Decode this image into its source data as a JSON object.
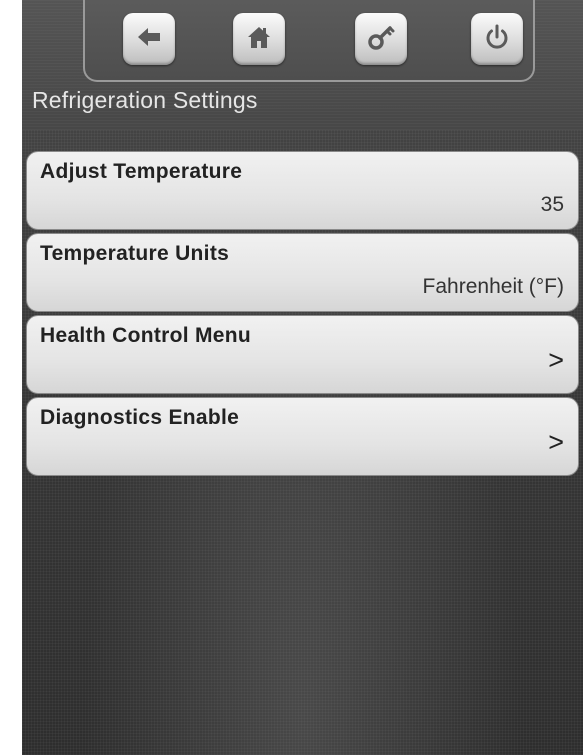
{
  "nav": {
    "buttons": [
      {
        "icon": "back-arrow-icon"
      },
      {
        "icon": "home-icon"
      },
      {
        "icon": "key-icon"
      },
      {
        "icon": "power-icon"
      }
    ]
  },
  "page": {
    "title": "Refrigeration Settings"
  },
  "menu": {
    "items": [
      {
        "label": "Adjust Temperature",
        "value": "35"
      },
      {
        "label": "Temperature Units",
        "value": "Fahrenheit (°F)"
      },
      {
        "label": "Health Control Menu",
        "chevron": ">"
      },
      {
        "label": "Diagnostics Enable",
        "chevron": ">"
      }
    ]
  },
  "colors": {
    "background": "#3e3e3e",
    "button_face": "#e4e4e4",
    "text_dark": "#222222",
    "title_text": "#e6e6e6",
    "icon_color": "#5a5a5a"
  }
}
